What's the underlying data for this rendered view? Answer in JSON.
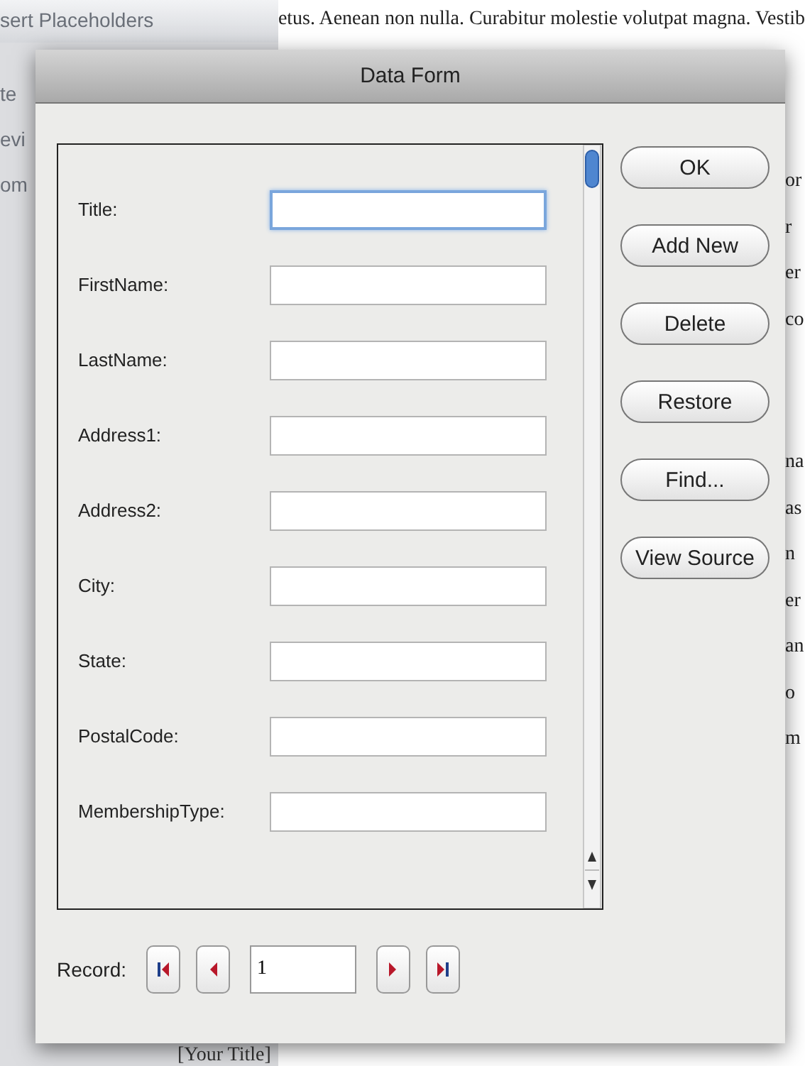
{
  "background": {
    "sidebar_heading": "sert Placeholders",
    "sidebar_items": [
      "te",
      "evi",
      "om"
    ],
    "document_line": "etus. Aenean non nulla. Curabitur molestie volutpat magna. Vestib",
    "right_fragments": [
      "or",
      "r",
      "er",
      "co",
      "na",
      "as",
      "n",
      "er",
      "an",
      "o",
      "m"
    ],
    "bottom_text": "[Your Title]"
  },
  "dialog": {
    "title": "Data Form",
    "fields": [
      {
        "label": "Title:",
        "focused": true
      },
      {
        "label": "FirstName:",
        "focused": false
      },
      {
        "label": "LastName:",
        "focused": false
      },
      {
        "label": "Address1:",
        "focused": false
      },
      {
        "label": "Address2:",
        "focused": false
      },
      {
        "label": "City:",
        "focused": false
      },
      {
        "label": "State:",
        "focused": false
      },
      {
        "label": "PostalCode:",
        "focused": false
      },
      {
        "label": "MembershipType:",
        "focused": false
      }
    ],
    "buttons": [
      "OK",
      "Add New",
      "Delete",
      "Restore",
      "Find...",
      "View Source"
    ],
    "record": {
      "label": "Record:",
      "value": "1"
    }
  }
}
